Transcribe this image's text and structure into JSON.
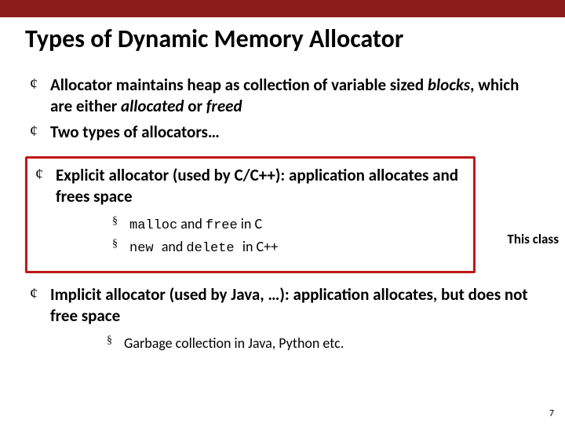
{
  "title": "Types of Dynamic Memory Allocator",
  "bullets": {
    "b1_pre": "Allocator maintains heap as collection of variable sized ",
    "b1_em": "blocks",
    "b1_mid": ", which are either ",
    "b1_em2": "allocated",
    "b1_mid2": " or ",
    "b1_em3": "freed",
    "b2": "Two types of allocators…",
    "b3": "Explicit allocator (used by C/C++): application allocates and frees space",
    "b3_sub1_code1": "malloc",
    "b3_sub1_mid": " and ",
    "b3_sub1_code2": "free",
    "b3_sub1_tail": " in C",
    "b3_sub2_code1": "new ",
    "b3_sub2_mid": "and ",
    "b3_sub2_code2": "delete ",
    "b3_sub2_tail": "in C++",
    "b4": "Implicit allocator (used by Java, …): application allocates, but does not free space",
    "b4_sub1": "Garbage collection in Java, Python etc."
  },
  "callout": "This class",
  "page_number": "7"
}
